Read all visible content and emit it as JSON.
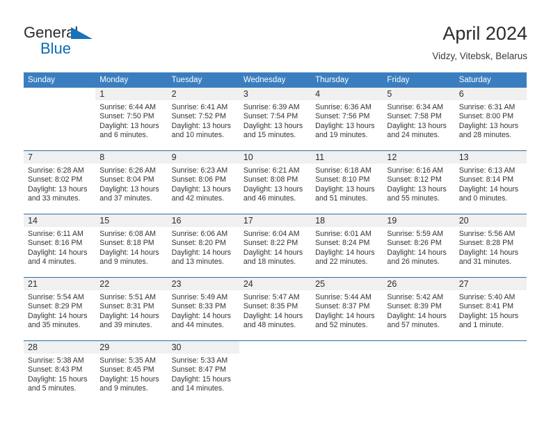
{
  "brand": {
    "name_line1": "General",
    "name_line2": "Blue",
    "flag_icon": "blue-triangle-flag-icon",
    "accent_color": "#0a6cb4"
  },
  "header": {
    "title": "April 2024",
    "location": "Vidzy, Vitebsk, Belarus"
  },
  "theme": {
    "header_bg": "#3a7ebf",
    "header_text": "#ffffff",
    "daynum_bg": "#f0f0f0",
    "week_divider": "#2d6da3",
    "body_text": "#333333"
  },
  "weekdays": [
    "Sunday",
    "Monday",
    "Tuesday",
    "Wednesday",
    "Thursday",
    "Friday",
    "Saturday"
  ],
  "weeks": [
    {
      "days": [
        {
          "num": "",
          "blank": true,
          "empty": true,
          "sunrise": "",
          "sunset": "",
          "daylight1": "",
          "daylight2": ""
        },
        {
          "num": "1",
          "sunrise": "Sunrise: 6:44 AM",
          "sunset": "Sunset: 7:50 PM",
          "daylight1": "Daylight: 13 hours",
          "daylight2": "and 6 minutes."
        },
        {
          "num": "2",
          "sunrise": "Sunrise: 6:41 AM",
          "sunset": "Sunset: 7:52 PM",
          "daylight1": "Daylight: 13 hours",
          "daylight2": "and 10 minutes."
        },
        {
          "num": "3",
          "sunrise": "Sunrise: 6:39 AM",
          "sunset": "Sunset: 7:54 PM",
          "daylight1": "Daylight: 13 hours",
          "daylight2": "and 15 minutes."
        },
        {
          "num": "4",
          "sunrise": "Sunrise: 6:36 AM",
          "sunset": "Sunset: 7:56 PM",
          "daylight1": "Daylight: 13 hours",
          "daylight2": "and 19 minutes."
        },
        {
          "num": "5",
          "sunrise": "Sunrise: 6:34 AM",
          "sunset": "Sunset: 7:58 PM",
          "daylight1": "Daylight: 13 hours",
          "daylight2": "and 24 minutes."
        },
        {
          "num": "6",
          "sunrise": "Sunrise: 6:31 AM",
          "sunset": "Sunset: 8:00 PM",
          "daylight1": "Daylight: 13 hours",
          "daylight2": "and 28 minutes."
        }
      ]
    },
    {
      "days": [
        {
          "num": "7",
          "sunrise": "Sunrise: 6:28 AM",
          "sunset": "Sunset: 8:02 PM",
          "daylight1": "Daylight: 13 hours",
          "daylight2": "and 33 minutes."
        },
        {
          "num": "8",
          "sunrise": "Sunrise: 6:26 AM",
          "sunset": "Sunset: 8:04 PM",
          "daylight1": "Daylight: 13 hours",
          "daylight2": "and 37 minutes."
        },
        {
          "num": "9",
          "sunrise": "Sunrise: 6:23 AM",
          "sunset": "Sunset: 8:06 PM",
          "daylight1": "Daylight: 13 hours",
          "daylight2": "and 42 minutes."
        },
        {
          "num": "10",
          "sunrise": "Sunrise: 6:21 AM",
          "sunset": "Sunset: 8:08 PM",
          "daylight1": "Daylight: 13 hours",
          "daylight2": "and 46 minutes."
        },
        {
          "num": "11",
          "sunrise": "Sunrise: 6:18 AM",
          "sunset": "Sunset: 8:10 PM",
          "daylight1": "Daylight: 13 hours",
          "daylight2": "and 51 minutes."
        },
        {
          "num": "12",
          "sunrise": "Sunrise: 6:16 AM",
          "sunset": "Sunset: 8:12 PM",
          "daylight1": "Daylight: 13 hours",
          "daylight2": "and 55 minutes."
        },
        {
          "num": "13",
          "sunrise": "Sunrise: 6:13 AM",
          "sunset": "Sunset: 8:14 PM",
          "daylight1": "Daylight: 14 hours",
          "daylight2": "and 0 minutes."
        }
      ]
    },
    {
      "days": [
        {
          "num": "14",
          "sunrise": "Sunrise: 6:11 AM",
          "sunset": "Sunset: 8:16 PM",
          "daylight1": "Daylight: 14 hours",
          "daylight2": "and 4 minutes."
        },
        {
          "num": "15",
          "sunrise": "Sunrise: 6:08 AM",
          "sunset": "Sunset: 8:18 PM",
          "daylight1": "Daylight: 14 hours",
          "daylight2": "and 9 minutes."
        },
        {
          "num": "16",
          "sunrise": "Sunrise: 6:06 AM",
          "sunset": "Sunset: 8:20 PM",
          "daylight1": "Daylight: 14 hours",
          "daylight2": "and 13 minutes."
        },
        {
          "num": "17",
          "sunrise": "Sunrise: 6:04 AM",
          "sunset": "Sunset: 8:22 PM",
          "daylight1": "Daylight: 14 hours",
          "daylight2": "and 18 minutes."
        },
        {
          "num": "18",
          "sunrise": "Sunrise: 6:01 AM",
          "sunset": "Sunset: 8:24 PM",
          "daylight1": "Daylight: 14 hours",
          "daylight2": "and 22 minutes."
        },
        {
          "num": "19",
          "sunrise": "Sunrise: 5:59 AM",
          "sunset": "Sunset: 8:26 PM",
          "daylight1": "Daylight: 14 hours",
          "daylight2": "and 26 minutes."
        },
        {
          "num": "20",
          "sunrise": "Sunrise: 5:56 AM",
          "sunset": "Sunset: 8:28 PM",
          "daylight1": "Daylight: 14 hours",
          "daylight2": "and 31 minutes."
        }
      ]
    },
    {
      "days": [
        {
          "num": "21",
          "sunrise": "Sunrise: 5:54 AM",
          "sunset": "Sunset: 8:29 PM",
          "daylight1": "Daylight: 14 hours",
          "daylight2": "and 35 minutes."
        },
        {
          "num": "22",
          "sunrise": "Sunrise: 5:51 AM",
          "sunset": "Sunset: 8:31 PM",
          "daylight1": "Daylight: 14 hours",
          "daylight2": "and 39 minutes."
        },
        {
          "num": "23",
          "sunrise": "Sunrise: 5:49 AM",
          "sunset": "Sunset: 8:33 PM",
          "daylight1": "Daylight: 14 hours",
          "daylight2": "and 44 minutes."
        },
        {
          "num": "24",
          "sunrise": "Sunrise: 5:47 AM",
          "sunset": "Sunset: 8:35 PM",
          "daylight1": "Daylight: 14 hours",
          "daylight2": "and 48 minutes."
        },
        {
          "num": "25",
          "sunrise": "Sunrise: 5:44 AM",
          "sunset": "Sunset: 8:37 PM",
          "daylight1": "Daylight: 14 hours",
          "daylight2": "and 52 minutes."
        },
        {
          "num": "26",
          "sunrise": "Sunrise: 5:42 AM",
          "sunset": "Sunset: 8:39 PM",
          "daylight1": "Daylight: 14 hours",
          "daylight2": "and 57 minutes."
        },
        {
          "num": "27",
          "sunrise": "Sunrise: 5:40 AM",
          "sunset": "Sunset: 8:41 PM",
          "daylight1": "Daylight: 15 hours",
          "daylight2": "and 1 minute."
        }
      ]
    },
    {
      "days": [
        {
          "num": "28",
          "sunrise": "Sunrise: 5:38 AM",
          "sunset": "Sunset: 8:43 PM",
          "daylight1": "Daylight: 15 hours",
          "daylight2": "and 5 minutes."
        },
        {
          "num": "29",
          "sunrise": "Sunrise: 5:35 AM",
          "sunset": "Sunset: 8:45 PM",
          "daylight1": "Daylight: 15 hours",
          "daylight2": "and 9 minutes."
        },
        {
          "num": "30",
          "sunrise": "Sunrise: 5:33 AM",
          "sunset": "Sunset: 8:47 PM",
          "daylight1": "Daylight: 15 hours",
          "daylight2": "and 14 minutes."
        },
        {
          "num": "",
          "blank": true,
          "empty": true,
          "sunrise": "",
          "sunset": "",
          "daylight1": "",
          "daylight2": ""
        },
        {
          "num": "",
          "blank": true,
          "empty": true,
          "sunrise": "",
          "sunset": "",
          "daylight1": "",
          "daylight2": ""
        },
        {
          "num": "",
          "blank": true,
          "empty": true,
          "sunrise": "",
          "sunset": "",
          "daylight1": "",
          "daylight2": ""
        },
        {
          "num": "",
          "blank": true,
          "empty": true,
          "sunrise": "",
          "sunset": "",
          "daylight1": "",
          "daylight2": ""
        }
      ]
    }
  ]
}
